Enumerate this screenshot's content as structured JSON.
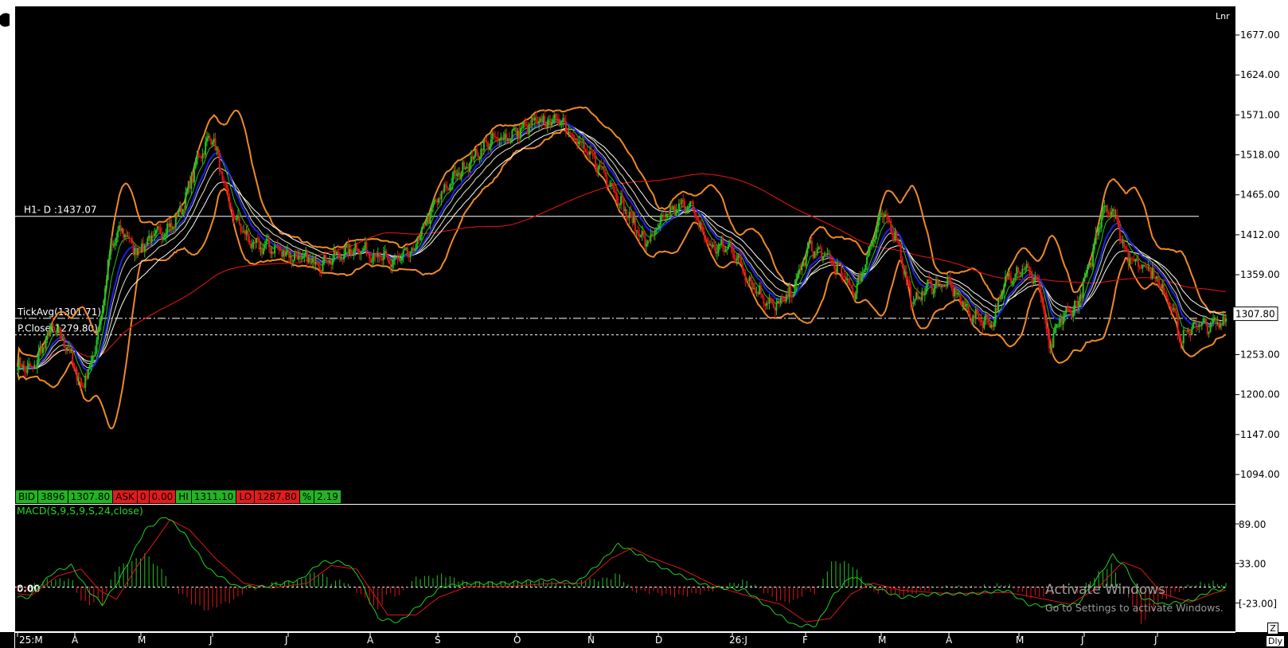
{
  "chart_data": {
    "type": "line",
    "scale": "Lnr",
    "x_ticks": [
      "25:M",
      "A",
      "M",
      "J",
      "J",
      "A",
      "S",
      "O",
      "N",
      "D",
      "26:J",
      "F",
      "M",
      "A",
      "M",
      "J",
      "J"
    ],
    "price_axis": {
      "ticks": [
        "1677.00",
        "1624.00",
        "1571.00",
        "1518.00",
        "1465.00",
        "1412.00",
        "1359.00",
        "1253.00",
        "1200.00",
        "1147.00",
        "1094.00"
      ],
      "ylim": [
        1055,
        1715
      ],
      "last_price_label": "1307.80"
    },
    "reference_lines": [
      {
        "label": "H1- D :1437.07",
        "value": 1437.07,
        "style": "solid"
      },
      {
        "label": "TickAvg(1301.71)",
        "value": 1301.71,
        "style": "dashdot"
      },
      {
        "label": "P.Close(1279.80)",
        "value": 1279.8,
        "style": "dashed"
      }
    ],
    "price_series": {
      "name": "close",
      "anchors": [
        [
          0,
          1240
        ],
        [
          10,
          1232
        ],
        [
          25,
          1290
        ],
        [
          35,
          1265
        ],
        [
          45,
          1210
        ],
        [
          52,
          1240
        ],
        [
          58,
          1290
        ],
        [
          66,
          1395
        ],
        [
          74,
          1420
        ],
        [
          84,
          1390
        ],
        [
          96,
          1410
        ],
        [
          110,
          1425
        ],
        [
          118,
          1455
        ],
        [
          128,
          1515
        ],
        [
          138,
          1545
        ],
        [
          145,
          1485
        ],
        [
          152,
          1440
        ],
        [
          166,
          1398
        ],
        [
          180,
          1395
        ],
        [
          200,
          1380
        ],
        [
          215,
          1375
        ],
        [
          240,
          1395
        ],
        [
          265,
          1375
        ],
        [
          280,
          1390
        ],
        [
          293,
          1445
        ],
        [
          305,
          1480
        ],
        [
          318,
          1505
        ],
        [
          333,
          1535
        ],
        [
          350,
          1545
        ],
        [
          365,
          1560
        ],
        [
          385,
          1565
        ],
        [
          403,
          1520
        ],
        [
          415,
          1495
        ],
        [
          430,
          1445
        ],
        [
          445,
          1400
        ],
        [
          460,
          1440
        ],
        [
          475,
          1455
        ],
        [
          490,
          1395
        ],
        [
          505,
          1395
        ],
        [
          520,
          1345
        ],
        [
          535,
          1315
        ],
        [
          548,
          1335
        ],
        [
          560,
          1395
        ],
        [
          575,
          1380
        ],
        [
          585,
          1355
        ],
        [
          593,
          1335
        ],
        [
          603,
          1395
        ],
        [
          612,
          1440
        ],
        [
          622,
          1410
        ],
        [
          633,
          1320
        ],
        [
          645,
          1345
        ],
        [
          660,
          1345
        ],
        [
          675,
          1305
        ],
        [
          690,
          1295
        ],
        [
          700,
          1355
        ],
        [
          712,
          1370
        ],
        [
          723,
          1345
        ],
        [
          730,
          1260
        ],
        [
          738,
          1300
        ],
        [
          750,
          1320
        ],
        [
          760,
          1380
        ],
        [
          768,
          1450
        ],
        [
          776,
          1440
        ],
        [
          786,
          1380
        ],
        [
          800,
          1370
        ],
        [
          810,
          1340
        ],
        [
          818,
          1315
        ],
        [
          823,
          1270
        ],
        [
          833,
          1295
        ],
        [
          843,
          1290
        ],
        [
          855,
          1300
        ]
      ]
    },
    "ohlc_bar": {
      "bid_label": "BID",
      "bid_size": "3896",
      "bid": "1307.80",
      "ask_label": "ASK",
      "ask_size": "0",
      "ask": "0.00",
      "hi_label": "HI",
      "hi": "1311.10",
      "lo_label": "LO",
      "lo": "1287.80",
      "pct_label": "%",
      "pct": "2.19"
    },
    "macd": {
      "label": "MACD(S,9,S,9,S,24,close)",
      "axis_ticks": [
        "89.00",
        "33.00",
        "[-23.00]"
      ],
      "ylim": [
        -62,
        115
      ],
      "zero_label": "0.00",
      "line_anchors": [
        [
          0,
          -15
        ],
        [
          8,
          -15
        ],
        [
          25,
          20
        ],
        [
          38,
          30
        ],
        [
          50,
          -5
        ],
        [
          60,
          -25
        ],
        [
          72,
          10
        ],
        [
          90,
          80
        ],
        [
          105,
          100
        ],
        [
          118,
          75
        ],
        [
          135,
          25
        ],
        [
          155,
          0
        ],
        [
          175,
          0
        ],
        [
          200,
          10
        ],
        [
          215,
          35
        ],
        [
          230,
          35
        ],
        [
          240,
          20
        ],
        [
          255,
          -45
        ],
        [
          270,
          -50
        ],
        [
          285,
          -25
        ],
        [
          300,
          0
        ],
        [
          320,
          5
        ],
        [
          345,
          5
        ],
        [
          375,
          10
        ],
        [
          395,
          5
        ],
        [
          410,
          30
        ],
        [
          425,
          60
        ],
        [
          440,
          45
        ],
        [
          458,
          25
        ],
        [
          470,
          15
        ],
        [
          490,
          0
        ],
        [
          515,
          -5
        ],
        [
          535,
          -35
        ],
        [
          550,
          -55
        ],
        [
          565,
          -55
        ],
        [
          578,
          -10
        ],
        [
          590,
          15
        ],
        [
          605,
          0
        ],
        [
          625,
          -15
        ],
        [
          650,
          -10
        ],
        [
          675,
          -10
        ],
        [
          700,
          -5
        ],
        [
          715,
          -25
        ],
        [
          730,
          -28
        ],
        [
          750,
          -25
        ],
        [
          765,
          15
        ],
        [
          775,
          45
        ],
        [
          785,
          25
        ],
        [
          795,
          -15
        ],
        [
          810,
          -25
        ],
        [
          830,
          -20
        ],
        [
          845,
          -5
        ],
        [
          855,
          -3
        ]
      ],
      "signal_anchors": [
        [
          0,
          -10
        ],
        [
          10,
          -12
        ],
        [
          28,
          15
        ],
        [
          45,
          25
        ],
        [
          58,
          -5
        ],
        [
          70,
          -18
        ],
        [
          85,
          30
        ],
        [
          108,
          95
        ],
        [
          122,
          80
        ],
        [
          140,
          40
        ],
        [
          160,
          5
        ],
        [
          180,
          -2
        ],
        [
          205,
          5
        ],
        [
          222,
          30
        ],
        [
          240,
          25
        ],
        [
          262,
          -40
        ],
        [
          282,
          -40
        ],
        [
          298,
          -15
        ],
        [
          318,
          0
        ],
        [
          345,
          0
        ],
        [
          380,
          5
        ],
        [
          400,
          5
        ],
        [
          420,
          40
        ],
        [
          435,
          55
        ],
        [
          450,
          40
        ],
        [
          470,
          25
        ],
        [
          495,
          0
        ],
        [
          520,
          -15
        ],
        [
          540,
          -25
        ],
        [
          558,
          -50
        ],
        [
          575,
          -45
        ],
        [
          590,
          -10
        ],
        [
          605,
          5
        ],
        [
          625,
          -5
        ],
        [
          660,
          -10
        ],
        [
          700,
          -8
        ],
        [
          720,
          -15
        ],
        [
          745,
          -25
        ],
        [
          765,
          0
        ],
        [
          782,
          35
        ],
        [
          795,
          25
        ],
        [
          810,
          -10
        ],
        [
          830,
          -22
        ],
        [
          845,
          -10
        ],
        [
          855,
          -5
        ]
      ]
    },
    "colors": {
      "background": "#000000",
      "bullish": "#22c322",
      "bearish": "#e01515",
      "bollinger": "#f08a24",
      "ema_fast": "#1c20e6",
      "ma_long": "#cc1111",
      "ma_mid1": "#ffffff",
      "ma_mid2": "#e8e8c0",
      "macd_line": "#1fd11f",
      "macd_signal": "#e01515",
      "grid": "#dddddd"
    }
  },
  "watermark": {
    "line1": "Activate Windows",
    "line2": "Go to Settings to activate Windows."
  },
  "corner_tools": {
    "zoom": "Z",
    "period": "Dly"
  }
}
